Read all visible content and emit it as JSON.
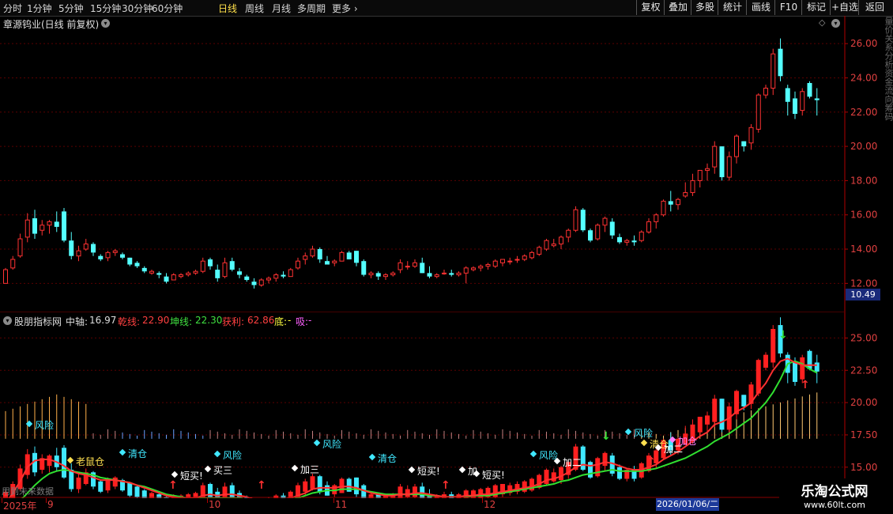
{
  "toolbar": {
    "periods": [
      "分时",
      "1分钟",
      "5分钟",
      "15分钟",
      "30分钟",
      "60分钟",
      "日线",
      "周线",
      "月线",
      "多周期",
      "更多"
    ],
    "active_period": "日线",
    "buttons": [
      "复权",
      "叠加",
      "多股",
      "统计",
      "画线",
      "F10",
      "标记",
      "+自选",
      "返回"
    ]
  },
  "stock": {
    "title": "章源钨业(日线 前复权)"
  },
  "price_axis": [
    "26.00",
    "24.00",
    "22.00",
    "20.00",
    "18.00",
    "16.00",
    "14.00",
    "12.00"
  ],
  "current_price_box": "10.49",
  "indicator": {
    "name": "股朋指标网",
    "mid_label": "中轴:",
    "mid_value": "16.97",
    "qian_label": "乾线:",
    "qian_value": "22.90",
    "kun_label": "坤线:",
    "kun_value": "22.30",
    "profit_label": "获利:",
    "profit_value": "62.86",
    "di_label": "底:",
    "di_value": "-",
    "xi_label": "吸:",
    "xi_value": "-"
  },
  "sub_axis": [
    "25.00",
    "22.50",
    "20.00",
    "17.50",
    "15.00"
  ],
  "signals": [
    "风险",
    "老鼠仓",
    "清仓",
    "短买!",
    "买三",
    "风险",
    "加三",
    "风险",
    "清仓",
    "短买!",
    "加",
    "短买!",
    "风险",
    "加二",
    "风险",
    "清仓",
    "加二",
    "加仓"
  ],
  "future_text": "用到未来数据",
  "date_axis": [
    "2025年",
    "9",
    "10",
    "11",
    "12"
  ],
  "date_highlight": "2026/01/06/二",
  "watermark": {
    "line1": "乐淘公式网",
    "line2": "www.60lt.com"
  },
  "right_strip_text": "量价关系分析资金流向筹码",
  "colors": {
    "up": "#ff3232",
    "down": "#54ffff",
    "qian": "#ff3030",
    "kun": "#30e030",
    "axis": "#b00000"
  },
  "chart_data": {
    "type": "candlestick",
    "ylim": [
      11.0,
      26.7
    ],
    "ohlc": [
      [
        12.0,
        12.9,
        12.0,
        12.8
      ],
      [
        12.9,
        13.6,
        12.8,
        13.4
      ],
      [
        13.6,
        14.9,
        13.5,
        14.6
      ],
      [
        14.7,
        16.1,
        14.4,
        15.7
      ],
      [
        15.8,
        16.3,
        14.6,
        14.9
      ],
      [
        15.1,
        15.7,
        14.8,
        15.4
      ],
      [
        15.4,
        15.7,
        14.9,
        15.6
      ],
      [
        15.6,
        16.2,
        15.0,
        15.3
      ],
      [
        16.2,
        16.4,
        14.4,
        14.5
      ],
      [
        14.5,
        15.0,
        13.4,
        13.6
      ],
      [
        13.6,
        14.2,
        13.3,
        13.9
      ],
      [
        14.0,
        14.6,
        13.9,
        14.3
      ],
      [
        14.3,
        14.4,
        13.6,
        13.8
      ],
      [
        13.6,
        13.7,
        13.3,
        13.4
      ],
      [
        13.5,
        13.9,
        13.3,
        13.8
      ],
      [
        13.8,
        14.0,
        13.6,
        13.9
      ],
      [
        13.7,
        13.8,
        13.4,
        13.5
      ],
      [
        13.5,
        13.5,
        13.0,
        13.1
      ],
      [
        13.2,
        13.3,
        12.9,
        13.0
      ],
      [
        12.9,
        13.0,
        12.6,
        12.7
      ],
      [
        12.6,
        12.8,
        12.5,
        12.7
      ],
      [
        12.6,
        12.7,
        12.3,
        12.5
      ],
      [
        12.4,
        12.6,
        12.0,
        12.1
      ],
      [
        12.2,
        12.6,
        12.2,
        12.5
      ],
      [
        12.4,
        12.6,
        12.3,
        12.5
      ],
      [
        12.5,
        12.7,
        12.4,
        12.6
      ],
      [
        12.6,
        12.8,
        12.5,
        12.7
      ],
      [
        12.7,
        13.5,
        12.6,
        13.3
      ],
      [
        13.4,
        13.5,
        12.8,
        13.0
      ],
      [
        12.8,
        13.1,
        12.1,
        12.3
      ],
      [
        12.4,
        13.5,
        12.3,
        13.2
      ],
      [
        13.3,
        13.5,
        12.7,
        12.8
      ],
      [
        12.7,
        12.9,
        12.3,
        12.5
      ],
      [
        12.4,
        12.5,
        12.1,
        12.2
      ],
      [
        12.1,
        12.3,
        11.7,
        11.9
      ],
      [
        11.9,
        12.3,
        11.8,
        12.2
      ],
      [
        12.2,
        12.4,
        12.0,
        12.3
      ],
      [
        12.3,
        12.6,
        12.1,
        12.5
      ],
      [
        12.5,
        12.7,
        12.3,
        12.4
      ],
      [
        12.4,
        12.9,
        12.4,
        12.8
      ],
      [
        12.9,
        13.5,
        12.8,
        13.3
      ],
      [
        13.4,
        13.8,
        13.1,
        13.6
      ],
      [
        13.6,
        14.2,
        13.5,
        14.0
      ],
      [
        14.0,
        14.1,
        13.2,
        13.4
      ],
      [
        13.3,
        13.6,
        13.1,
        13.1
      ],
      [
        13.2,
        13.4,
        13.0,
        13.3
      ],
      [
        13.3,
        13.9,
        13.3,
        13.8
      ],
      [
        13.8,
        13.9,
        13.4,
        13.4
      ],
      [
        13.9,
        13.9,
        13.0,
        13.2
      ],
      [
        13.3,
        13.4,
        12.4,
        12.5
      ],
      [
        12.5,
        12.7,
        12.3,
        12.6
      ],
      [
        12.6,
        12.7,
        12.2,
        12.4
      ],
      [
        12.4,
        12.6,
        12.2,
        12.5
      ],
      [
        12.5,
        12.7,
        12.4,
        12.6
      ],
      [
        12.8,
        13.4,
        12.6,
        13.2
      ],
      [
        13.0,
        13.3,
        12.8,
        13.0
      ],
      [
        13.0,
        13.4,
        12.9,
        13.2
      ],
      [
        13.2,
        13.5,
        12.6,
        12.6
      ],
      [
        12.6,
        13.0,
        12.3,
        12.4
      ],
      [
        12.4,
        12.6,
        12.3,
        12.5
      ],
      [
        12.6,
        12.8,
        12.5,
        12.6
      ],
      [
        12.6,
        12.8,
        12.4,
        12.5
      ],
      [
        12.5,
        12.7,
        12.4,
        12.6
      ],
      [
        12.6,
        13.0,
        12.0,
        12.9
      ],
      [
        12.8,
        13.0,
        12.7,
        12.9
      ],
      [
        12.9,
        13.1,
        12.7,
        13.0
      ],
      [
        13.0,
        13.2,
        12.8,
        13.1
      ],
      [
        13.0,
        13.4,
        12.9,
        13.3
      ],
      [
        13.2,
        13.4,
        13.0,
        13.4
      ],
      [
        13.3,
        13.5,
        13.1,
        13.3
      ],
      [
        13.4,
        13.6,
        13.2,
        13.4
      ],
      [
        13.4,
        13.7,
        13.3,
        13.6
      ],
      [
        13.5,
        13.9,
        13.4,
        13.8
      ],
      [
        13.7,
        14.2,
        13.6,
        14.1
      ],
      [
        14.0,
        14.6,
        13.9,
        14.5
      ],
      [
        14.2,
        14.6,
        14.1,
        14.3
      ],
      [
        14.3,
        14.8,
        14.0,
        14.7
      ],
      [
        14.7,
        15.2,
        14.4,
        15.1
      ],
      [
        15.1,
        16.5,
        15.0,
        16.3
      ],
      [
        16.3,
        16.4,
        15.0,
        15.1
      ],
      [
        15.1,
        15.2,
        14.4,
        14.5
      ],
      [
        14.6,
        15.5,
        14.5,
        15.4
      ],
      [
        15.4,
        15.9,
        15.0,
        15.8
      ],
      [
        15.6,
        15.8,
        14.6,
        14.8
      ],
      [
        14.7,
        14.9,
        14.3,
        14.4
      ],
      [
        14.4,
        14.6,
        14.2,
        14.5
      ],
      [
        14.5,
        14.8,
        14.2,
        14.4
      ],
      [
        14.5,
        15.1,
        14.4,
        15.0
      ],
      [
        15.0,
        15.8,
        14.9,
        15.6
      ],
      [
        15.6,
        16.1,
        15.2,
        16.0
      ],
      [
        16.0,
        16.9,
        15.9,
        16.8
      ],
      [
        16.8,
        17.4,
        16.2,
        16.6
      ],
      [
        16.6,
        17.0,
        16.3,
        16.9
      ],
      [
        17.1,
        17.9,
        17.0,
        17.3
      ],
      [
        17.3,
        18.4,
        17.1,
        18.0
      ],
      [
        18.0,
        18.6,
        17.6,
        18.6
      ],
      [
        18.6,
        19.0,
        18.0,
        18.7
      ],
      [
        18.8,
        20.3,
        18.4,
        20.0
      ],
      [
        20.0,
        20.0,
        18.0,
        18.2
      ],
      [
        18.2,
        19.7,
        18.0,
        19.4
      ],
      [
        19.4,
        20.7,
        19.0,
        20.6
      ],
      [
        20.3,
        20.3,
        19.7,
        20.0
      ],
      [
        20.2,
        21.3,
        19.8,
        21.1
      ],
      [
        21.0,
        23.1,
        20.8,
        23.0
      ],
      [
        23.0,
        23.6,
        22.8,
        23.4
      ],
      [
        23.4,
        25.7,
        23.0,
        25.4
      ],
      [
        25.7,
        26.3,
        23.8,
        24.1
      ],
      [
        23.4,
        23.6,
        21.8,
        22.6
      ],
      [
        22.8,
        23.2,
        21.6,
        21.9
      ],
      [
        22.1,
        23.4,
        21.8,
        23.2
      ],
      [
        23.7,
        23.8,
        22.8,
        22.9
      ],
      [
        22.8,
        23.4,
        21.8,
        22.7
      ]
    ],
    "qian_line": [
      12.2,
      13.0,
      13.9,
      15.0,
      15.5,
      15.6,
      15.6,
      15.4,
      15.1,
      14.7,
      14.5,
      14.4,
      14.2,
      14.0,
      14.0,
      14.0,
      13.9,
      13.8,
      13.6,
      13.4,
      13.2,
      13.0,
      12.8,
      12.7,
      12.6,
      12.6,
      12.6,
      12.8,
      12.9,
      12.8,
      12.9,
      12.9,
      12.8,
      12.7,
      12.5,
      12.4,
      12.4,
      12.4,
      12.5,
      12.6,
      12.8,
      13.0,
      13.3,
      13.4,
      13.4,
      13.4,
      13.5,
      13.5,
      13.4,
      13.2,
      13.0,
      12.9,
      12.8,
      12.8,
      12.9,
      12.9,
      13.0,
      13.0,
      12.9,
      12.8,
      12.7,
      12.7,
      12.7,
      12.8,
      12.8,
      12.9,
      12.9,
      13.0,
      13.1,
      13.2,
      13.3,
      13.4,
      13.5,
      13.7,
      14.0,
      14.1,
      14.3,
      14.6,
      15.0,
      15.2,
      15.1,
      15.2,
      15.4,
      15.3,
      15.1,
      14.9,
      14.8,
      14.8,
      15.0,
      15.2,
      15.6,
      15.9,
      16.2,
      16.6,
      17.0,
      17.4,
      17.7,
      18.3,
      18.5,
      18.8,
      19.3,
      19.6,
      20.0,
      20.8,
      21.5,
      22.5,
      23.2,
      23.4,
      23.1,
      22.9,
      22.9,
      22.9
    ],
    "kun_line": [
      11.5,
      11.9,
      12.4,
      13.0,
      13.6,
      14.1,
      14.5,
      14.7,
      14.8,
      14.7,
      14.6,
      14.5,
      14.4,
      14.2,
      14.1,
      14.0,
      13.9,
      13.8,
      13.6,
      13.5,
      13.3,
      13.1,
      12.9,
      12.8,
      12.7,
      12.6,
      12.6,
      12.6,
      12.6,
      12.6,
      12.6,
      12.6,
      12.6,
      12.5,
      12.4,
      12.4,
      12.4,
      12.4,
      12.4,
      12.5,
      12.6,
      12.8,
      13.0,
      13.1,
      13.2,
      13.2,
      13.3,
      13.3,
      13.3,
      13.2,
      13.1,
      13.0,
      12.9,
      12.9,
      12.9,
      12.9,
      12.9,
      12.9,
      12.8,
      12.8,
      12.7,
      12.7,
      12.7,
      12.7,
      12.8,
      12.8,
      12.8,
      12.9,
      13.0,
      13.1,
      13.2,
      13.3,
      13.4,
      13.5,
      13.6,
      13.7,
      13.9,
      14.0,
      14.2,
      14.4,
      14.5,
      14.6,
      14.7,
      14.8,
      14.7,
      14.7,
      14.7,
      14.7,
      14.8,
      14.9,
      15.1,
      15.3,
      15.5,
      15.7,
      16.0,
      16.3,
      16.6,
      17.0,
      17.3,
      17.6,
      18.0,
      18.4,
      18.8,
      19.4,
      20.0,
      20.8,
      21.8,
      23.0,
      23.2,
      23.0,
      22.6,
      22.3
    ],
    "sub_ylim": [
      12.6,
      26.8
    ]
  }
}
